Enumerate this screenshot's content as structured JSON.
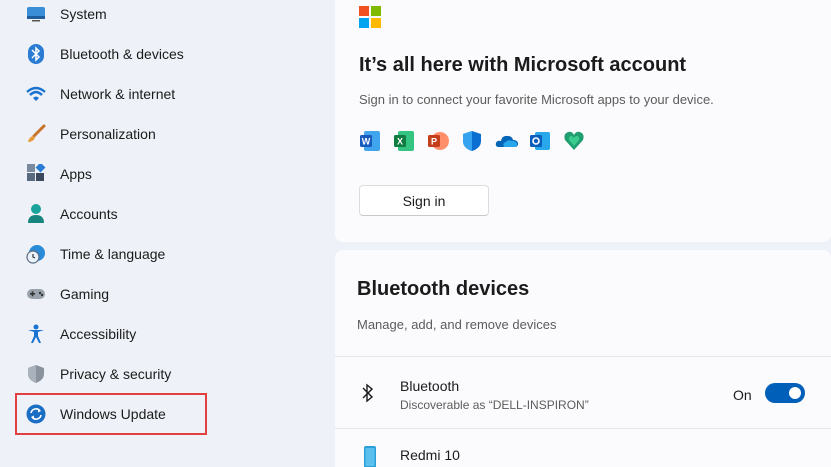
{
  "sidebar": {
    "items": [
      {
        "label": "System",
        "icon": "monitor-icon"
      },
      {
        "label": "Bluetooth & devices",
        "icon": "bluetooth-icon"
      },
      {
        "label": "Network & internet",
        "icon": "wifi-icon"
      },
      {
        "label": "Personalization",
        "icon": "brush-icon"
      },
      {
        "label": "Apps",
        "icon": "apps-icon"
      },
      {
        "label": "Accounts",
        "icon": "person-icon"
      },
      {
        "label": "Time & language",
        "icon": "globe-clock-icon"
      },
      {
        "label": "Gaming",
        "icon": "gamepad-icon"
      },
      {
        "label": "Accessibility",
        "icon": "accessibility-icon"
      },
      {
        "label": "Privacy & security",
        "icon": "shield-icon"
      },
      {
        "label": "Windows Update",
        "icon": "sync-icon"
      }
    ]
  },
  "microsoft_card": {
    "title": "It’s all here with Microsoft account",
    "subtitle": "Sign in to connect your favorite Microsoft apps to your device.",
    "apps": [
      "word-icon",
      "excel-icon",
      "powerpoint-icon",
      "defender-icon",
      "onedrive-icon",
      "outlook-icon",
      "family-icon"
    ],
    "signin_label": "Sign in"
  },
  "bluetooth_card": {
    "title": "Bluetooth devices",
    "subtitle": "Manage, add, and remove devices",
    "bluetooth_row": {
      "title": "Bluetooth",
      "subtitle": "Discoverable as “DELL-INSPIRON”",
      "toggle_label": "On",
      "toggle_on": true
    },
    "device_row": {
      "title": "Redmi 10",
      "more_label": "..."
    }
  },
  "colors": {
    "accent": "#005fb8",
    "highlight_border": "#e0403f"
  }
}
